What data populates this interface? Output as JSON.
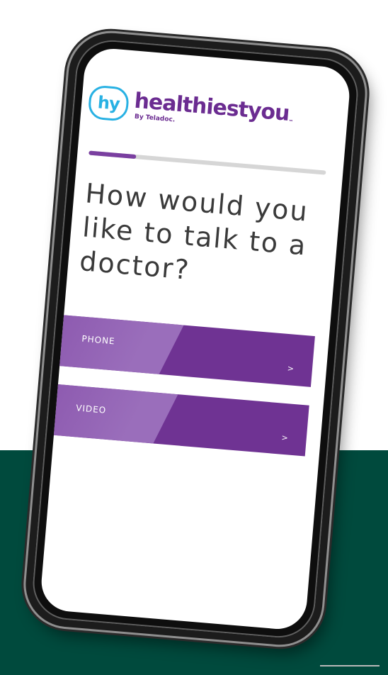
{
  "brand": {
    "logo_mark": "hy",
    "name": "healthiestyou",
    "trademark": "™",
    "byline": "By Teladoc."
  },
  "progress": {
    "fraction": 0.2
  },
  "question": {
    "text": "How would you like to talk to a doctor?"
  },
  "options": [
    {
      "label": "PHONE",
      "arrow": ">"
    },
    {
      "label": "VIDEO",
      "arrow": ">"
    }
  ],
  "colors": {
    "brand_purple": "#6b2c91",
    "option_purple": "#6f3393",
    "logo_blue": "#28b1e3",
    "background_green": "#004a3d",
    "progress_track": "#d6d6d6"
  }
}
